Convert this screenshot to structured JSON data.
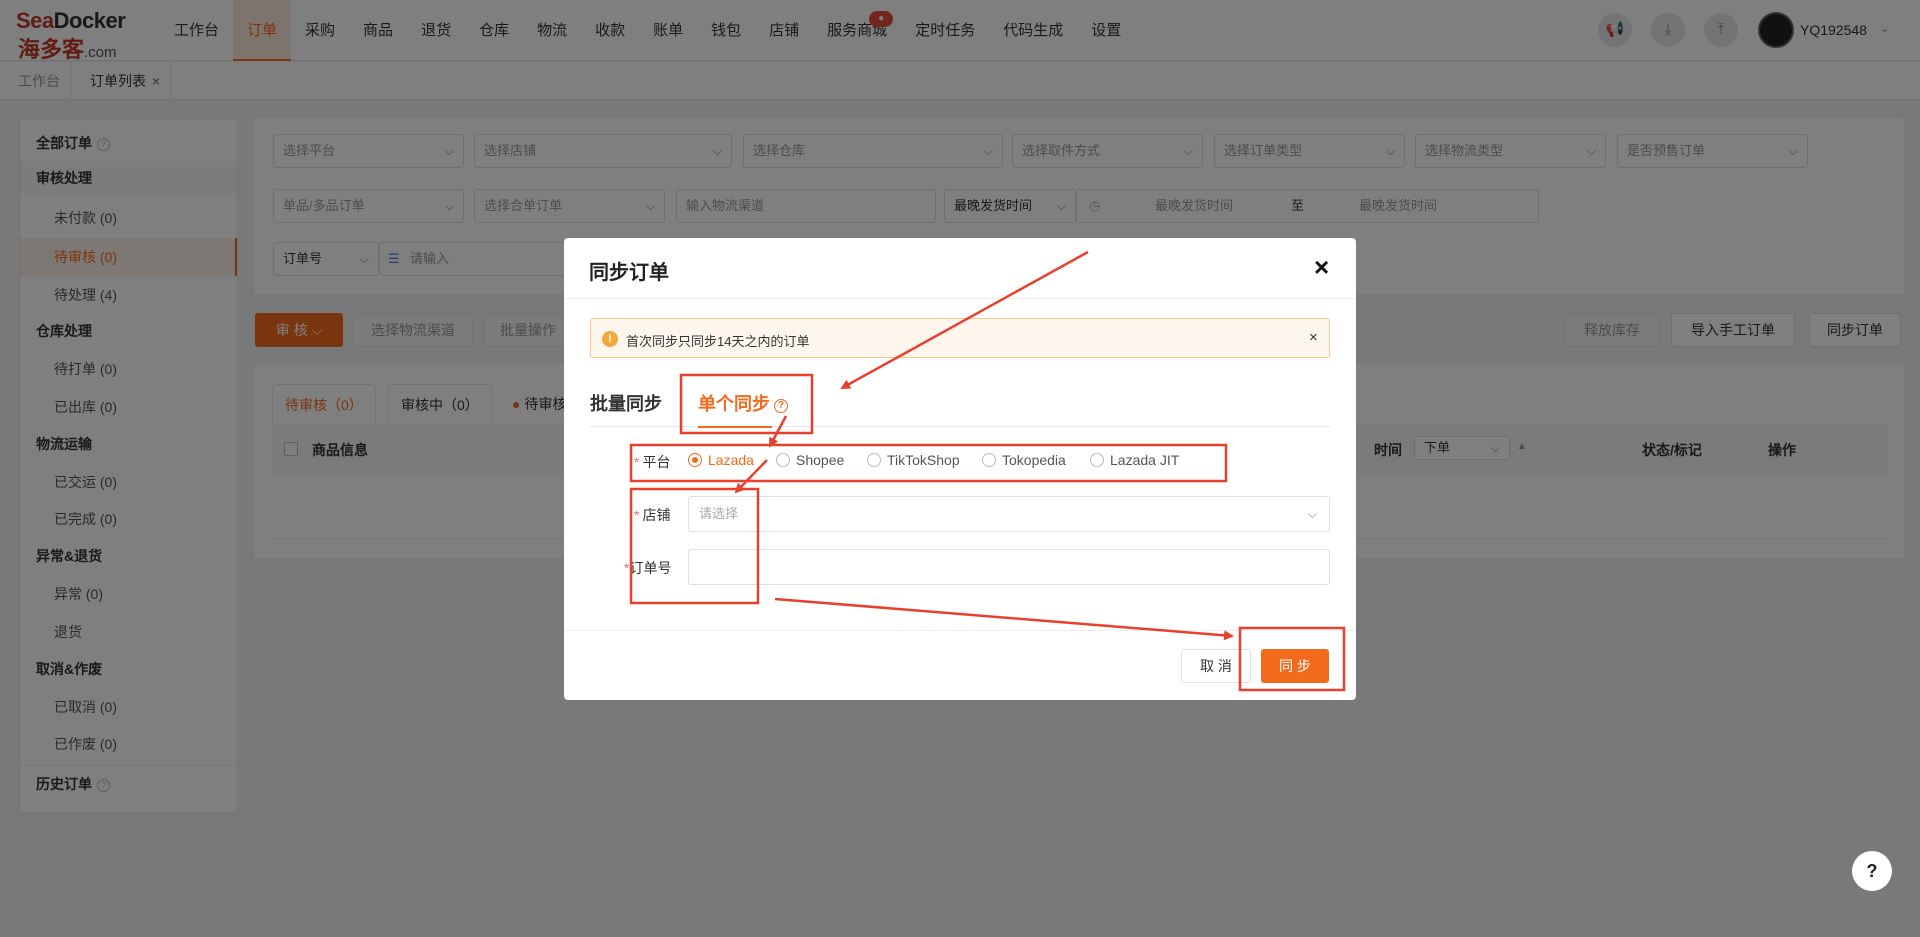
{
  "logo": {
    "line1a": "Sea",
    "line1b": "Docker",
    "line2": "海多客",
    "line2_suffix": ".com"
  },
  "nav": [
    "工作台",
    "订单",
    "采购",
    "商品",
    "退货",
    "仓库",
    "物流",
    "收款",
    "账单",
    "钱包",
    "店铺",
    "服务商城",
    "定时任务",
    "代码生成",
    "设置"
  ],
  "nav_active_index": 1,
  "nav_badge": "●",
  "user": {
    "name": "YQ192548",
    "caret": "⌄"
  },
  "tabs": {
    "home": "工作台",
    "orders": "订单列表",
    "close": "×"
  },
  "sidebar": {
    "all_orders": "全部订单",
    "groups": [
      {
        "title": "审核处理",
        "items": [
          "未付款 (0)",
          "待审核 (0)",
          "待处理 (4)"
        ]
      },
      {
        "title": "仓库处理",
        "items": [
          "待打单 (0)",
          "已出库 (0)"
        ]
      },
      {
        "title": "物流运输",
        "items": [
          "已交运 (0)",
          "已完成 (0)"
        ]
      },
      {
        "title": "异常&退货",
        "items": [
          "异常 (0)",
          "退货"
        ]
      },
      {
        "title": "取消&作废",
        "items": [
          "已取消 (0)",
          "已作废 (0)"
        ]
      }
    ],
    "history": "历史订单",
    "active_item": "待审核 (0)"
  },
  "filters": {
    "row1": [
      "选择平台",
      "选择店铺",
      "选择仓库",
      "选择取件方式",
      "选择订单类型",
      "选择物流类型",
      "是否预售订单"
    ],
    "row2_a": "单品/多品订单",
    "row2_b": "选择合单订单",
    "row2_c": "输入物流渠道",
    "row2_d": "最晚发货时间",
    "date_start": "最晚发货时间",
    "date_to": "至",
    "date_end": "最晚发货时间",
    "order_no": "订单号",
    "order_input": "请输入"
  },
  "actions": {
    "review": "审 核",
    "select_channel": "选择物流渠道",
    "batch_ops": "批量操作",
    "release_stock": "释放库存",
    "import_manual": "导入手工订单",
    "sync_orders": "同步订单"
  },
  "order_tabs": [
    "待审核（0）",
    "审核中（0）",
    "待审核"
  ],
  "table": {
    "col_product": "商品信息",
    "col_time": "时间",
    "time_select": "下单",
    "col_status": "状态/标记",
    "col_ops": "操作"
  },
  "modal": {
    "title": "同步订单",
    "close": "×",
    "alert": "首次同步只同步14天之内的订单",
    "alert_close": "×",
    "tab_batch": "批量同步",
    "tab_single": "单个同步",
    "platform_label": "平台",
    "platforms": [
      "Lazada",
      "Shopee",
      "TikTokShop",
      "Tokopedia",
      "Lazada JIT"
    ],
    "selected_platform": "Lazada",
    "shop_label": "店铺",
    "shop_placeholder": "请选择",
    "order_label": "订单号",
    "order_value": "",
    "cancel": "取 消",
    "confirm": "同 步"
  },
  "help_button": "?",
  "accent_color": "#f26b1d",
  "annotation_color": "#e8402e"
}
